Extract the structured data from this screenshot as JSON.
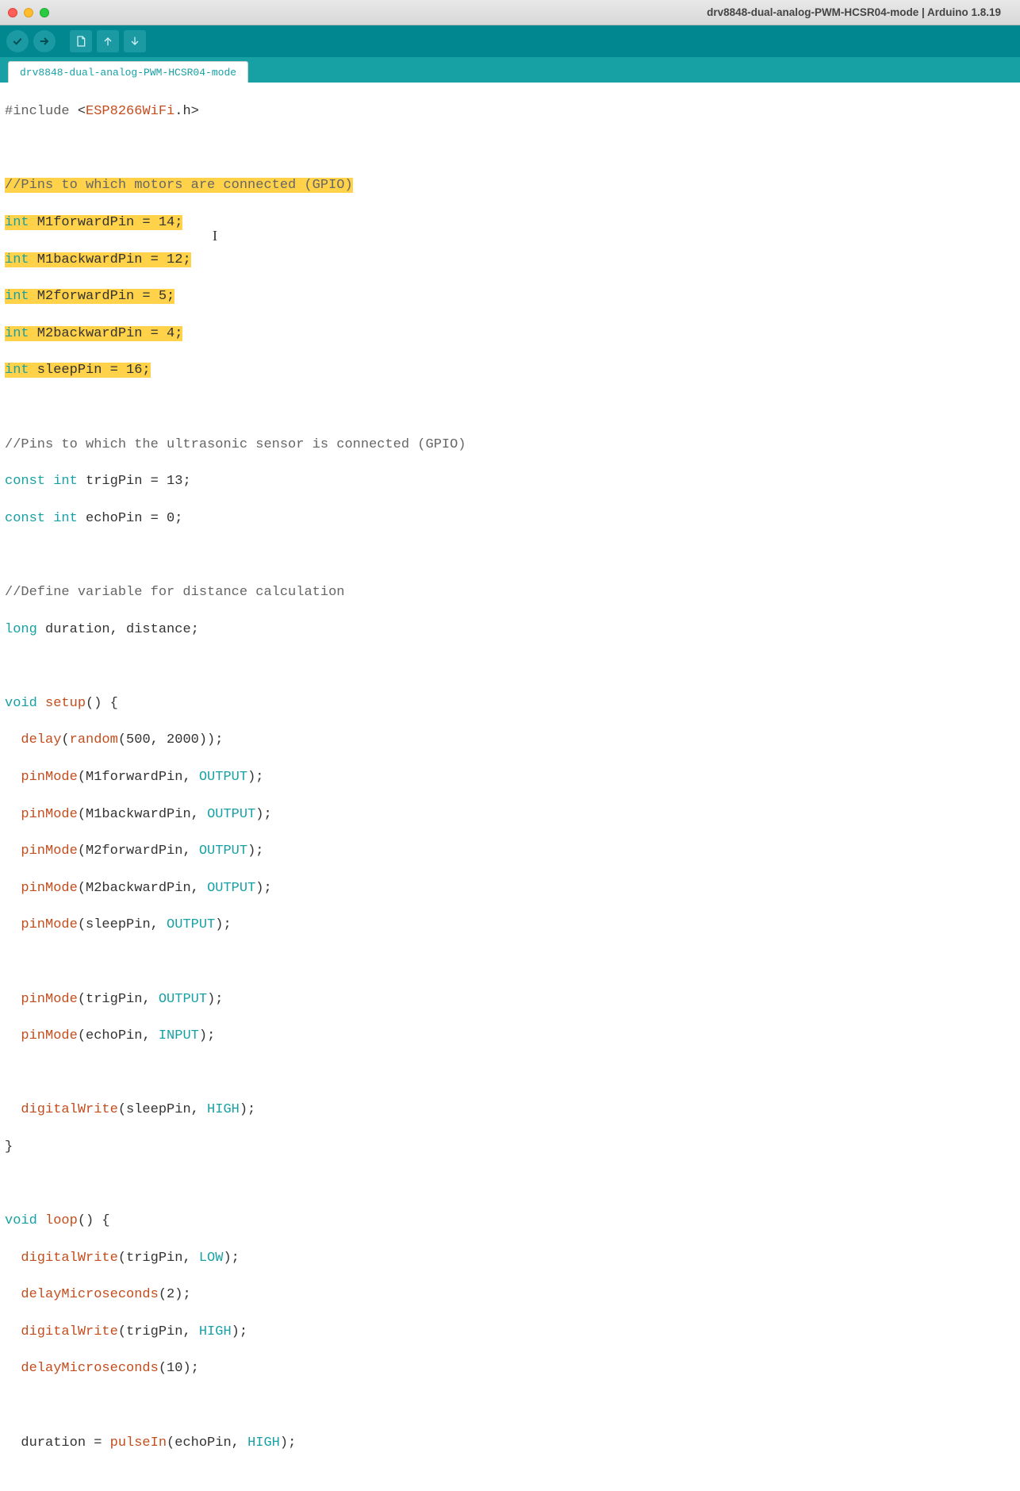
{
  "window": {
    "title": "drv8848-dual-analog-PWM-HCSR04-mode | Arduino 1.8.19"
  },
  "tab": {
    "label": "drv8848-dual-analog-PWM-HCSR04-mode"
  },
  "toolbar": {
    "verify": "Verify",
    "upload": "Upload",
    "new": "New",
    "open": "Open",
    "save": "Save"
  },
  "code": {
    "l1_pre": "#include ",
    "l1_lt": "<",
    "l1_lib": "ESP8266WiFi",
    "l1_ext": ".h>",
    "l3_comment": "//Pins to which motors are connected (GPIO)",
    "l4_type": "int",
    "l4_rest": " M1forwardPin = 14;",
    "l5_type": "int",
    "l5_rest": " M1backwardPin = 12;",
    "l6_type": "int",
    "l6_rest": " M2forwardPin = 5;",
    "l7_type": "int",
    "l7_rest": " M2backwardPin = 4;",
    "l8_type": "int",
    "l8_rest": " sleepPin = 16;",
    "l10_comment": "//Pins to which the ultrasonic sensor is connected (GPIO)",
    "l11_a": "const int",
    "l11_b": " trigPin = 13;",
    "l12_a": "const int",
    "l12_b": " echoPin = 0;",
    "l14_comment": "//Define variable for distance calculation",
    "l15_type": "long",
    "l15_rest": " duration, distance;",
    "l17_kw": "void",
    "l17_fn": "setup",
    "l17_rest": "() {",
    "l18_a": "  ",
    "l18_fn1": "delay",
    "l18_b": "(",
    "l18_fn2": "random",
    "l18_c": "(500, 2000));",
    "l19_a": "  ",
    "l19_fn": "pinMode",
    "l19_b": "(M1forwardPin, ",
    "l19_c": "OUTPUT",
    "l19_d": ");",
    "l20_a": "  ",
    "l20_fn": "pinMode",
    "l20_b": "(M1backwardPin, ",
    "l20_c": "OUTPUT",
    "l20_d": ");",
    "l21_a": "  ",
    "l21_fn": "pinMode",
    "l21_b": "(M2forwardPin, ",
    "l21_c": "OUTPUT",
    "l21_d": ");",
    "l22_a": "  ",
    "l22_fn": "pinMode",
    "l22_b": "(M2backwardPin, ",
    "l22_c": "OUTPUT",
    "l22_d": ");",
    "l23_a": "  ",
    "l23_fn": "pinMode",
    "l23_b": "(sleepPin, ",
    "l23_c": "OUTPUT",
    "l23_d": ");",
    "l25_a": "  ",
    "l25_fn": "pinMode",
    "l25_b": "(trigPin, ",
    "l25_c": "OUTPUT",
    "l25_d": ");",
    "l26_a": "  ",
    "l26_fn": "pinMode",
    "l26_b": "(echoPin, ",
    "l26_c": "INPUT",
    "l26_d": ");",
    "l28_a": "  ",
    "l28_fn": "digitalWrite",
    "l28_b": "(sleepPin, ",
    "l28_c": "HIGH",
    "l28_d": ");",
    "l29": "}",
    "l31_kw": "void",
    "l31_fn": "loop",
    "l31_rest": "() {",
    "l32_a": "  ",
    "l32_fn": "digitalWrite",
    "l32_b": "(trigPin, ",
    "l32_c": "LOW",
    "l32_d": ");",
    "l33_a": "  ",
    "l33_fn": "delayMicroseconds",
    "l33_b": "(2);",
    "l34_a": "  ",
    "l34_fn": "digitalWrite",
    "l34_b": "(trigPin, ",
    "l34_c": "HIGH",
    "l34_d": ");",
    "l35_a": "  ",
    "l35_fn": "delayMicroseconds",
    "l35_b": "(10);",
    "l37_a": "  duration = ",
    "l37_fn": "pulseIn",
    "l37_b": "(echoPin, ",
    "l37_c": "HIGH",
    "l37_d": ");"
  },
  "colors": {
    "teal": "#00878f",
    "tab_teal": "#17a1a5",
    "highlight": "#ffd24a",
    "orange": "#c34d1d"
  }
}
